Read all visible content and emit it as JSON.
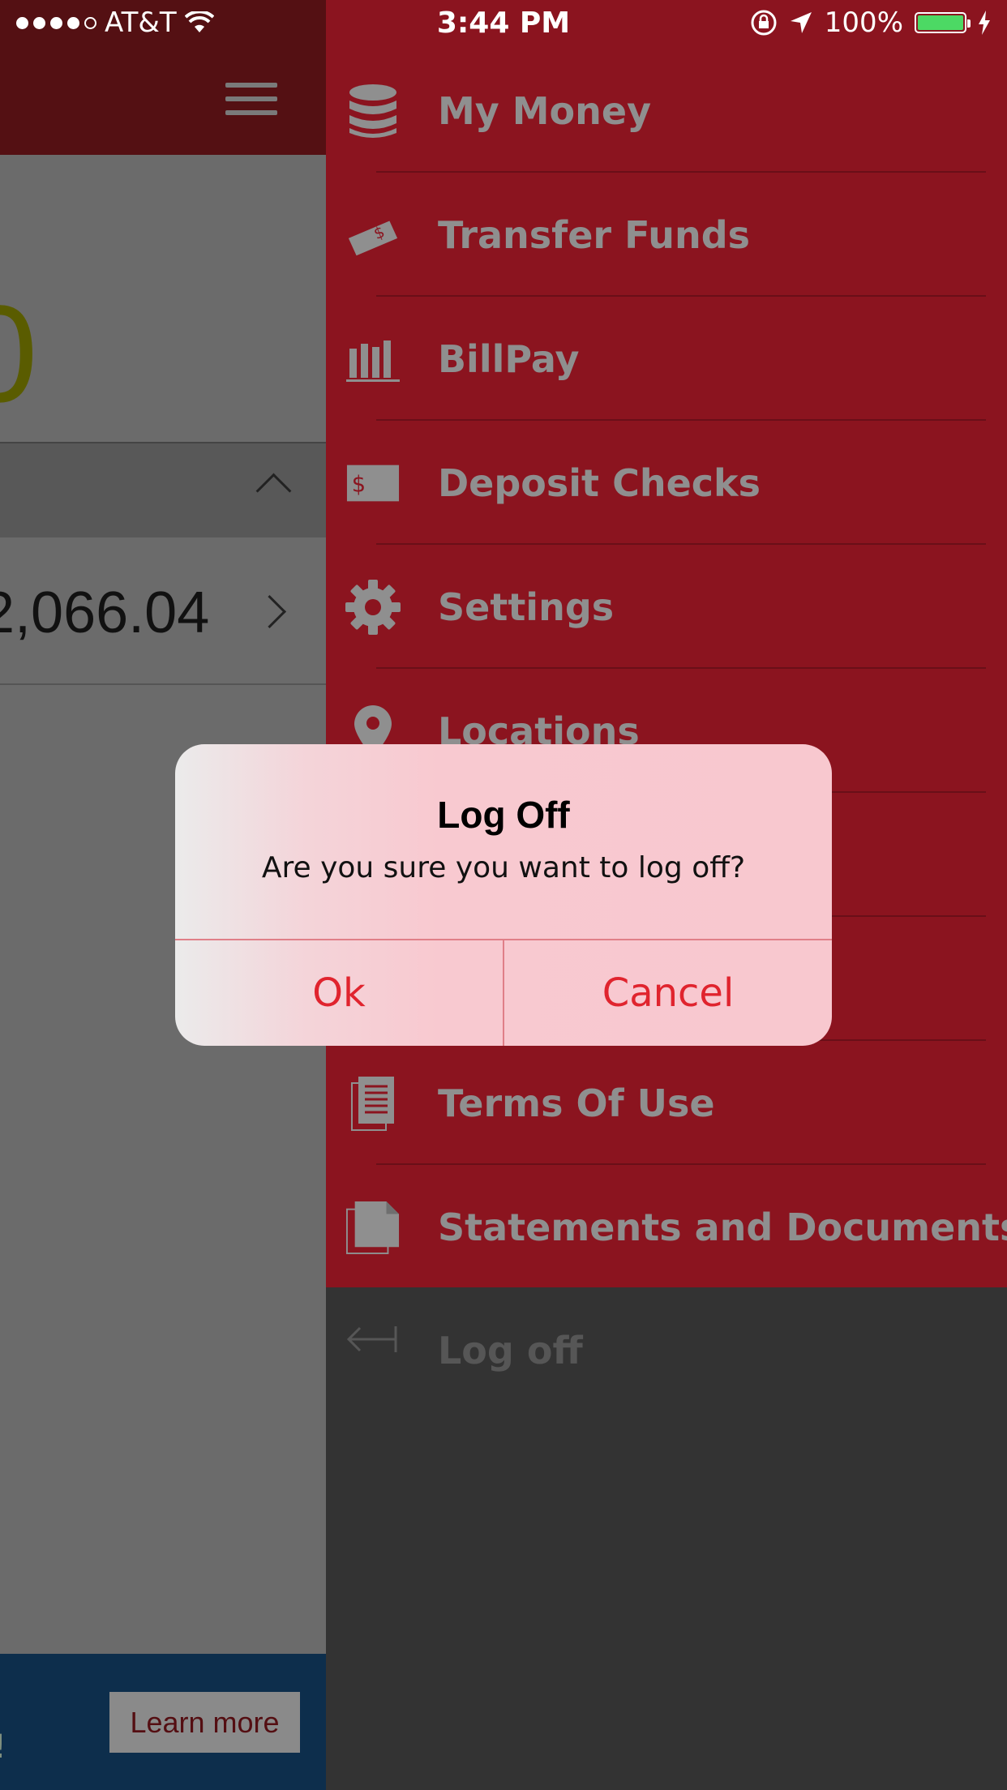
{
  "status_bar": {
    "carrier": "AT&T",
    "time": "3:44 PM",
    "battery": "100%"
  },
  "background_screen": {
    "balance_partial": "0",
    "account_amount_partial": "2,066.04",
    "promo_partial": "!",
    "learn_more": "Learn more"
  },
  "menu": {
    "items": [
      {
        "label": "My Money",
        "icon": "coins-stack-icon"
      },
      {
        "label": "Transfer Funds",
        "icon": "cash-transfer-icon"
      },
      {
        "label": "BillPay",
        "icon": "billpay-icon"
      },
      {
        "label": "Deposit Checks",
        "icon": "check-deposit-icon"
      },
      {
        "label": "Settings",
        "icon": "gear-icon"
      },
      {
        "label": "Locations",
        "icon": "location-pin-icon"
      },
      {
        "label": "",
        "icon": ""
      },
      {
        "label": "",
        "icon": ""
      },
      {
        "label": "Terms Of Use",
        "icon": "document-icon"
      },
      {
        "label": "Statements and Documents",
        "icon": "documents-icon"
      }
    ],
    "log_off": "Log off"
  },
  "alert": {
    "title": "Log Off",
    "message": "Are you sure you want to log off?",
    "ok": "Ok",
    "cancel": "Cancel"
  },
  "colors": {
    "drawer_red": "#8b141f",
    "alert_button_red": "#e0242e"
  }
}
